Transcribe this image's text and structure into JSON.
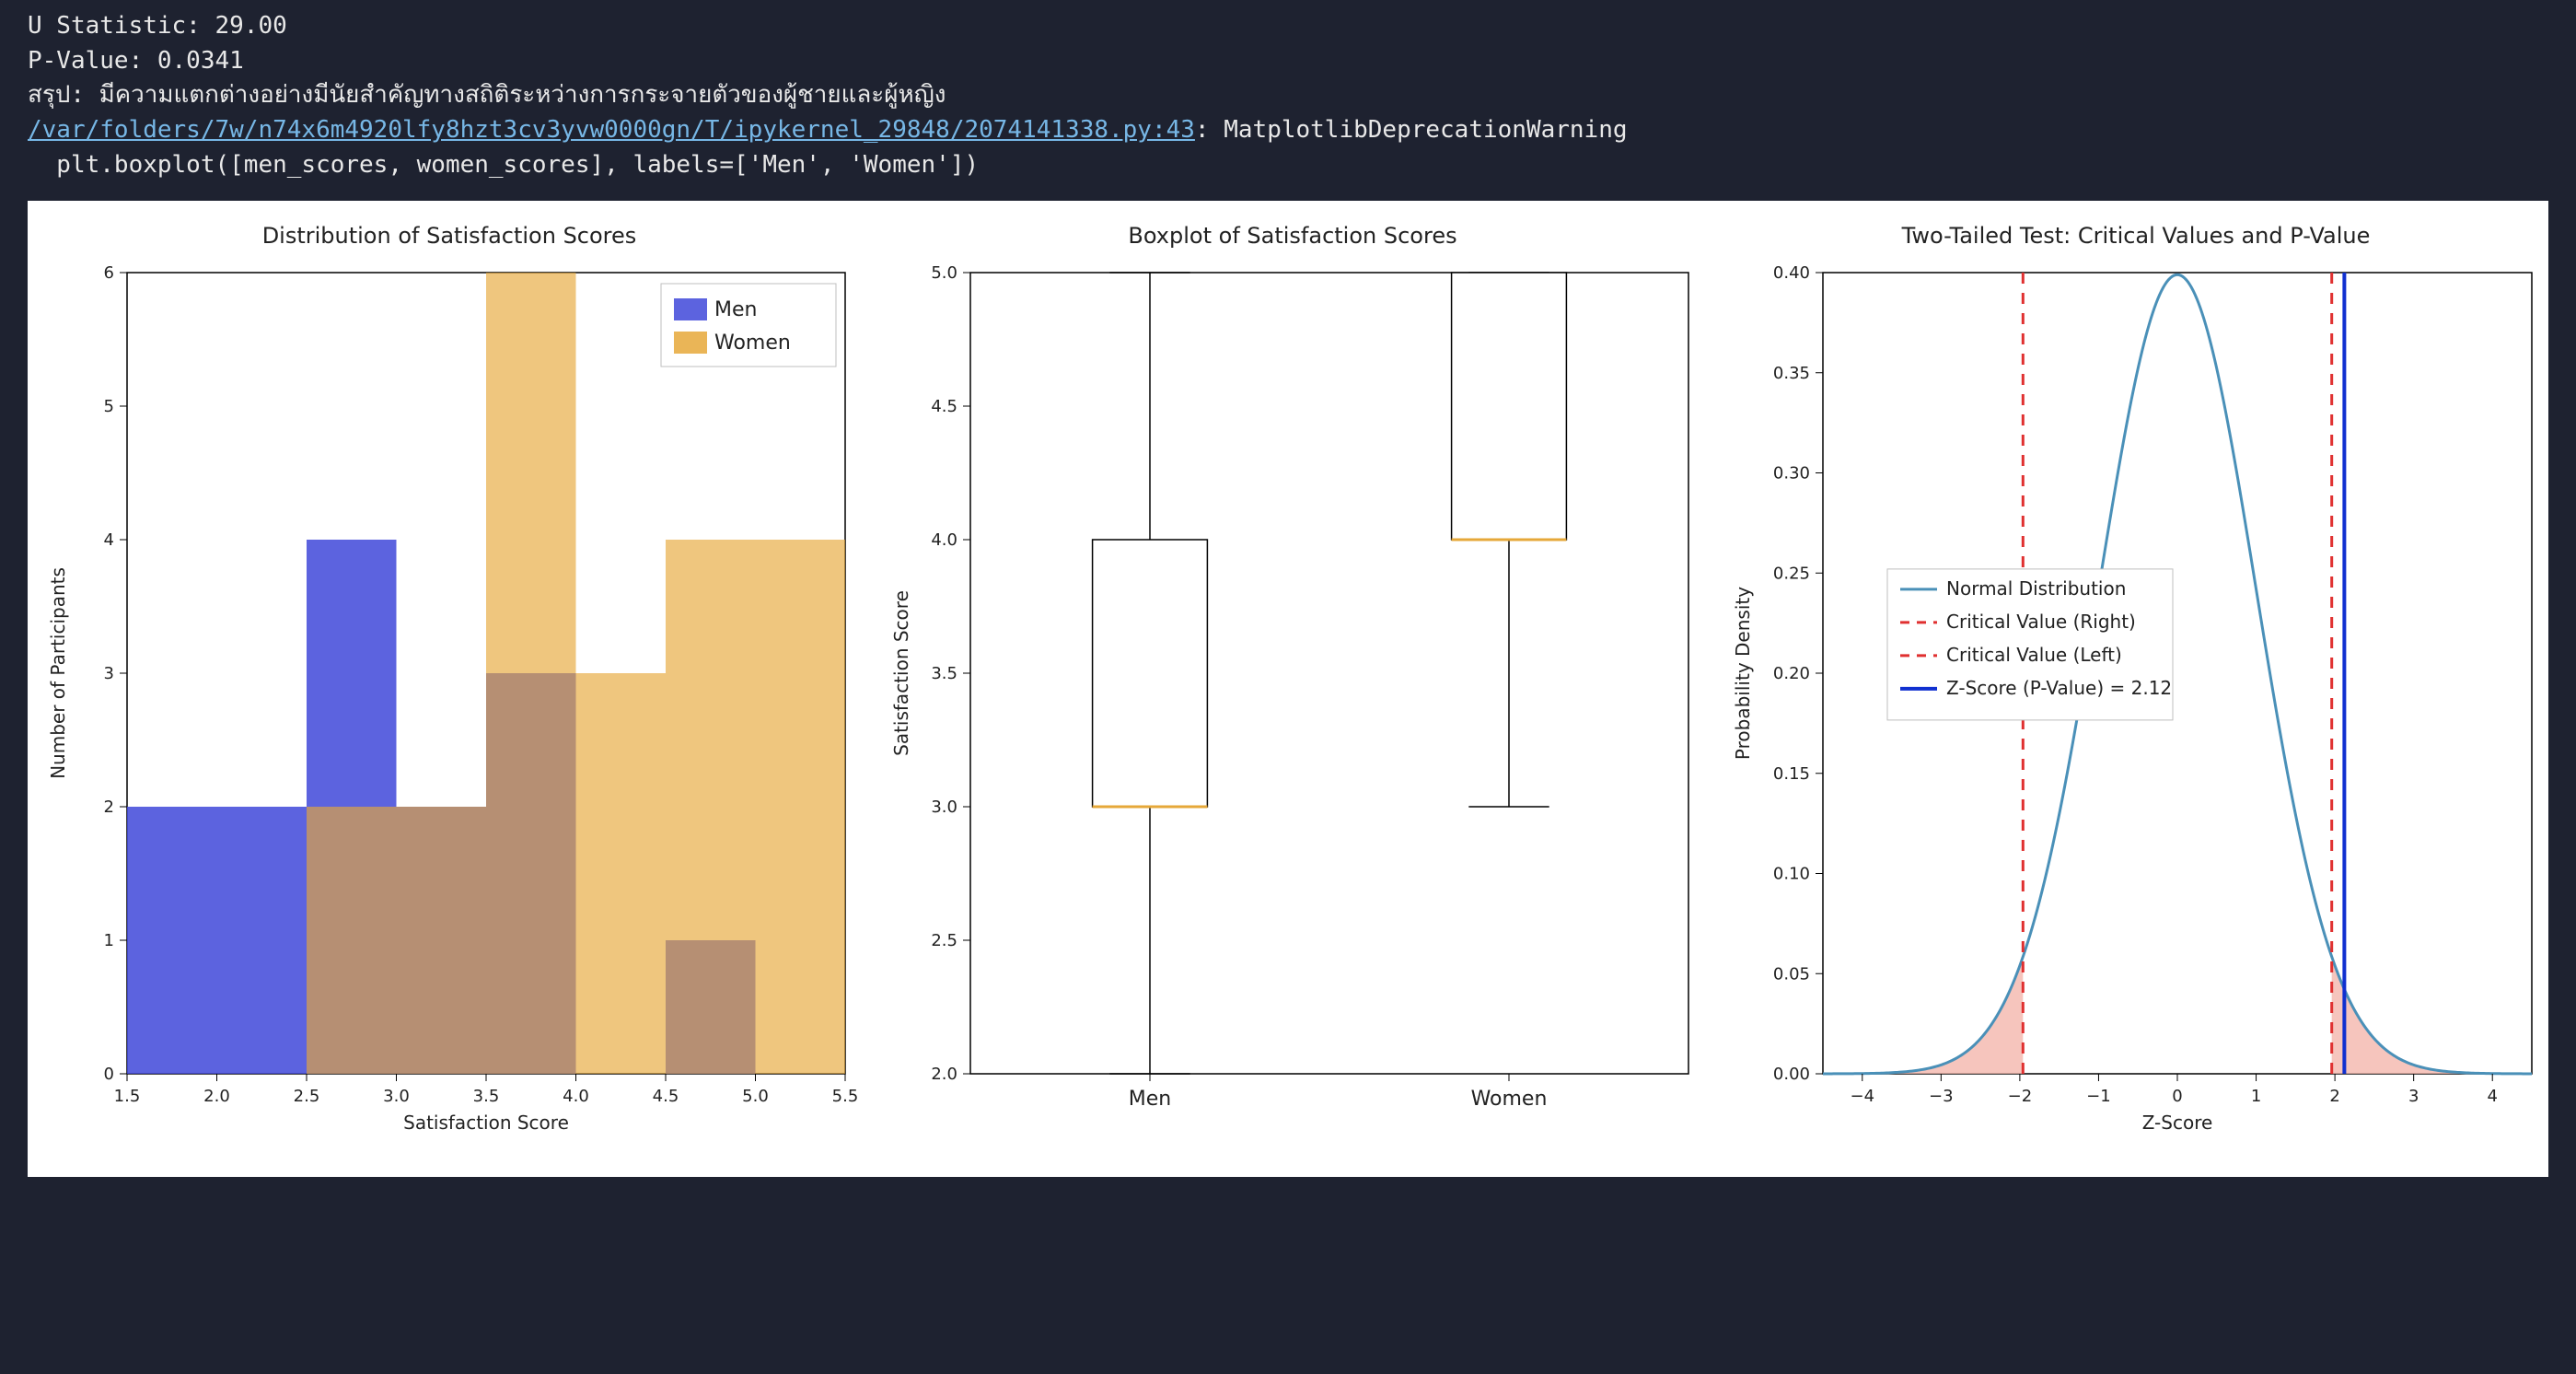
{
  "console": {
    "line1": "U Statistic: 29.00",
    "line2": "P-Value: 0.0341",
    "line3": "สรุป: มีความแตกต่างอย่างมีนัยสำคัญทางสถิติระหว่างการกระจายตัวของผู้ชายและผู้หญิง",
    "warn_path": "/var/folders/7w/n74x6m4920lfy8hzt3cv3yvw0000gn/T/ipykernel_29848/2074141338.py:43",
    "warn_suffix": ": MatplotlibDeprecationWarning",
    "code_line": "  plt.boxplot([men_scores, women_scores], labels=['Men', 'Women'])"
  },
  "chart_data": [
    {
      "type": "bar",
      "title": "Distribution of Satisfaction Scores",
      "xlabel": "Satisfaction Score",
      "ylabel": "Number of Participants",
      "bin_edges": [
        1.5,
        2.0,
        2.5,
        3.0,
        3.5,
        4.0,
        4.5,
        5.0,
        5.5
      ],
      "series": [
        {
          "name": "Men",
          "color": "#3f48d9",
          "values": [
            2,
            2,
            4,
            2,
            3,
            0,
            1,
            0
          ]
        },
        {
          "name": "Women",
          "color": "#e6a839",
          "values": [
            0,
            0,
            2,
            2,
            6,
            3,
            4,
            4
          ]
        }
      ],
      "ylim": [
        0,
        6
      ],
      "xlim": [
        1.5,
        5.5
      ],
      "xticks": [
        1.5,
        2.0,
        2.5,
        3.0,
        3.5,
        4.0,
        4.5,
        5.0,
        5.5
      ],
      "yticks": [
        0,
        1,
        2,
        3,
        4,
        5,
        6
      ],
      "legend": [
        "Men",
        "Women"
      ]
    },
    {
      "type": "boxplot",
      "title": "Boxplot of Satisfaction Scores",
      "xlabel": "",
      "ylabel": "Satisfaction Score",
      "categories": [
        "Men",
        "Women"
      ],
      "boxes": [
        {
          "name": "Men",
          "whisker_lo": 2.0,
          "q1": 3.0,
          "median": 3.0,
          "q3": 4.0,
          "whisker_hi": 5.0
        },
        {
          "name": "Women",
          "whisker_lo": 3.0,
          "q1": 4.0,
          "median": 4.0,
          "q3": 5.0,
          "whisker_hi": 5.0
        }
      ],
      "ylim": [
        2.0,
        5.0
      ],
      "yticks": [
        2.0,
        2.5,
        3.0,
        3.5,
        4.0,
        4.5,
        5.0
      ],
      "median_color": "#e6a839"
    },
    {
      "type": "line",
      "title": "Two-Tailed Test: Critical Values and P-Value",
      "xlabel": "Z-Score",
      "ylabel": "Probability Density",
      "xlim": [
        -4.5,
        4.5
      ],
      "ylim": [
        0.0,
        0.4
      ],
      "xticks": [
        -4,
        -3,
        -2,
        -1,
        0,
        1,
        2,
        3,
        4
      ],
      "yticks": [
        0.0,
        0.05,
        0.1,
        0.15,
        0.2,
        0.25,
        0.3,
        0.35,
        0.4
      ],
      "curve": "standard_normal_pdf",
      "critical_left": -1.96,
      "critical_right": 1.96,
      "z_score": 2.12,
      "shade_color": "#f4b6ad",
      "line_color": "#4a90b8",
      "crit_color": "#e03030",
      "z_color": "#1030d0",
      "legend": [
        "Normal Distribution",
        "Critical Value (Right)",
        "Critical Value (Left)",
        "Z-Score (P-Value) = 2.12"
      ]
    }
  ]
}
